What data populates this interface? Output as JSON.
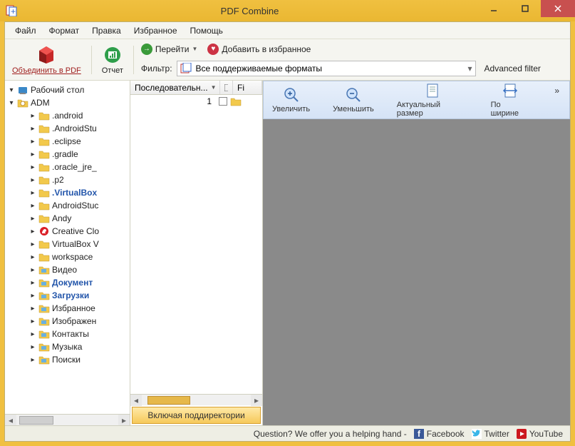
{
  "window": {
    "title": "PDF Combine"
  },
  "menu": [
    "Файл",
    "Формат",
    "Правка",
    "Избранное",
    "Помощь"
  ],
  "toolbar": {
    "combine": "Объединить в PDF",
    "report": "Отчет",
    "go": "Перейти",
    "fav": "Добавить в избранное",
    "filter_label": "Фильтр:",
    "filter_value": "Все поддерживаемые форматы",
    "advanced": "Advanced filter"
  },
  "tree": {
    "root": "Рабочий стол",
    "user": "ADM",
    "items": [
      {
        "name": ".android"
      },
      {
        "name": ".AndroidStu"
      },
      {
        "name": ".eclipse"
      },
      {
        "name": ".gradle"
      },
      {
        "name": ".oracle_jre_"
      },
      {
        "name": ".p2"
      },
      {
        "name": ".VirtualBox",
        "bold": true
      },
      {
        "name": "AndroidStuc"
      },
      {
        "name": "Andy"
      },
      {
        "name": "Creative Clo",
        "adobe": true
      },
      {
        "name": "VirtualBox V"
      },
      {
        "name": "workspace"
      },
      {
        "name": "Видео",
        "sys": true
      },
      {
        "name": "Документ",
        "bold": true,
        "sys": true
      },
      {
        "name": "Загрузки",
        "bold": true,
        "sys": true
      },
      {
        "name": "Избранное",
        "sys": true
      },
      {
        "name": "Изображен",
        "sys": true
      },
      {
        "name": "Контакты",
        "sys": true
      },
      {
        "name": "Музыка",
        "sys": true
      },
      {
        "name": "Поиски",
        "sys": true
      }
    ]
  },
  "list": {
    "col_seq": "Последовательн...",
    "col_fi": "Fi",
    "row_num": "1"
  },
  "preview": {
    "zoom_in": "Увеличить",
    "zoom_out": "Уменьшить",
    "actual": "Актуальный размер",
    "fit_width": "По ширине",
    "more": "»"
  },
  "subdirs_btn": "Включая поддиректории",
  "status": {
    "question": "Question? We offer you a helping hand  -",
    "fb": "Facebook",
    "tw": "Twitter",
    "yt": "YouTube"
  }
}
